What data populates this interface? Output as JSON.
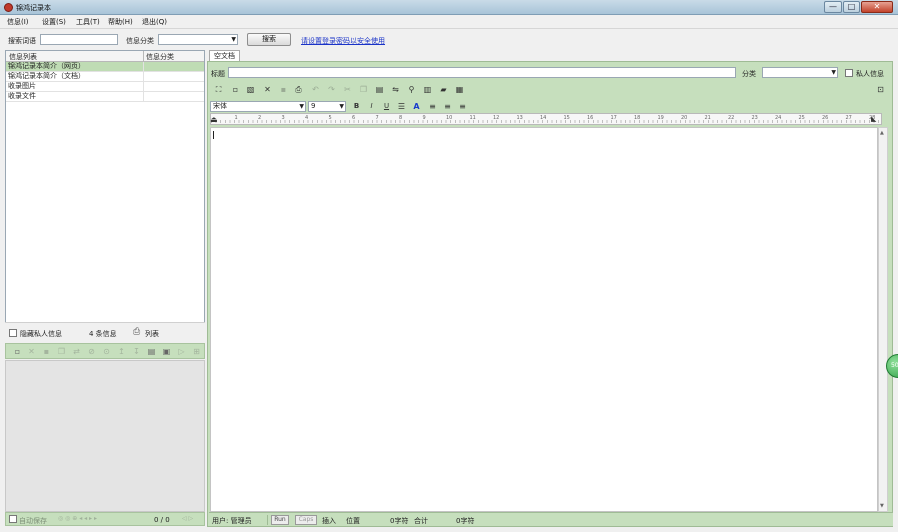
{
  "window": {
    "title": "锦鸿记录本",
    "controls": {
      "minimize": "—",
      "maximize": "□",
      "close": "✕"
    }
  },
  "menu": {
    "items": [
      "信息(I)",
      "设置(S)",
      "工具(T)",
      "帮助(H)",
      "退出(Q)"
    ]
  },
  "search": {
    "keyword_label": "搜索词语",
    "keyword_value": "",
    "category_label": "信息分类",
    "category_value": "",
    "search_button": "搜索",
    "link_text": "请设置登录密码以安全使用"
  },
  "list": {
    "headers": [
      "信息列表",
      "信息分类"
    ],
    "rows": [
      {
        "title": "锦鸿记录本简介（网页）",
        "category": ""
      },
      {
        "title": "锦鸿记录本简介（文档）",
        "category": ""
      },
      {
        "title": "收录图片",
        "category": ""
      },
      {
        "title": "收录文件",
        "category": ""
      }
    ],
    "hide_private_label": "隐藏私人信息",
    "count_label": "4 条信息",
    "list_button": "列表"
  },
  "left_status": {
    "auto_save_label": "自动保存",
    "page_count": "0 / 0"
  },
  "editor": {
    "tab_label": "空文档",
    "title_label": "标题",
    "title_value": "",
    "category_label": "分类",
    "category_value": "",
    "private_label": "私人信息",
    "font_name": "宋体",
    "font_size": "9",
    "bold": "B",
    "italic": "I",
    "underline": "U",
    "color": "A"
  },
  "status": {
    "user_label": "用户: 管理员",
    "btn_run": "Run",
    "btn_caps": "Caps",
    "insert_label": "插入",
    "position_label": "位置",
    "chars_label": "0字符",
    "total_label": "合计",
    "total_chars": "0字符"
  },
  "float_ball": "50"
}
